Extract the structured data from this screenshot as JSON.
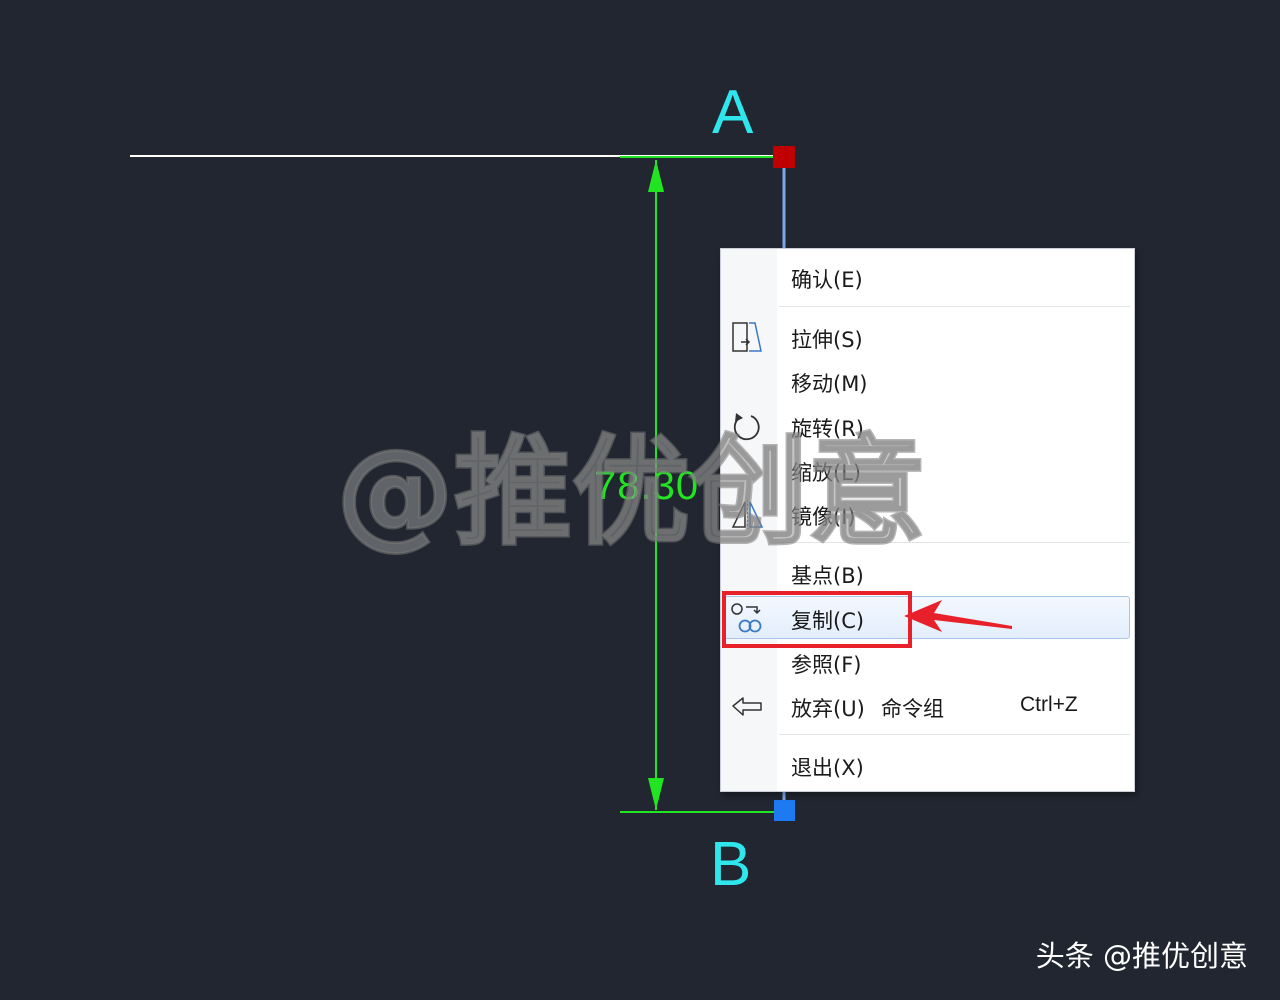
{
  "drawing": {
    "point_a": "A",
    "point_b": "B",
    "dimension_value": "78.30",
    "watermark": "@推优创意",
    "line_color": "#ffffff",
    "dimension_color": "#22e522",
    "label_color": "#2ee6ec",
    "grip_top_color": "#c00000",
    "grip_bottom_color": "#1e7af0"
  },
  "context_menu": {
    "items": [
      {
        "label": "确认(E)",
        "icon": ""
      },
      {
        "label": "拉伸(S)",
        "icon": "stretch-icon"
      },
      {
        "label": "移动(M)",
        "icon": ""
      },
      {
        "label": "旋转(R)",
        "icon": "rotate-icon"
      },
      {
        "label": "缩放(L)",
        "icon": ""
      },
      {
        "label": "镜像(I)",
        "icon": "mirror-icon"
      },
      {
        "label": "基点(B)",
        "icon": ""
      },
      {
        "label": "复制(C)",
        "icon": "copy-icon",
        "highlighted": true
      },
      {
        "label": "参照(F)",
        "icon": ""
      },
      {
        "label": "放弃(U)",
        "icon": "undo-icon",
        "extra": "命令组",
        "shortcut": "Ctrl+Z"
      },
      {
        "label": "退出(X)",
        "icon": ""
      }
    ]
  },
  "annotation": {
    "highlight_color": "#e8202a"
  },
  "credit": "头条 @推优创意"
}
